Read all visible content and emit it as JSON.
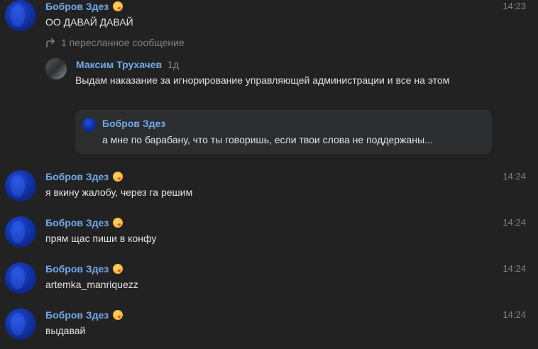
{
  "messages": [
    {
      "author": "Бобров Здез",
      "time": "14:23",
      "text": "ОО ДАВАЙ ДАВАЙ",
      "forwarded_label": "1 пересланное сообщение",
      "forwarded": {
        "author": "Максим Трухачев",
        "when": "1д",
        "text": "Выдам наказание за игнорирование управляющей администрации и все на этом",
        "reply": {
          "author": "Бобров Здез",
          "text": "а мне по барабану, что ты говоришь, если твои слова не поддержаны..."
        }
      }
    },
    {
      "author": "Бобров Здез",
      "time": "14:24",
      "text": "я вкину жалобу, через га решим"
    },
    {
      "author": "Бобров Здез",
      "time": "14:24",
      "text": "прям щас пиши в конфу"
    },
    {
      "author": "Бобров Здез",
      "time": "14:24",
      "text": "artemka_manriquezz"
    },
    {
      "author": "Бобров Здез",
      "time": "14:24",
      "text": "выдавай"
    }
  ],
  "icons": {
    "author_emoji": "face-blowing-kiss-icon",
    "forward": "forward-arrow-icon"
  },
  "colors": {
    "background": "#222222",
    "author_name": "#71aaeb",
    "text": "#e1e3e6",
    "muted": "#828282",
    "reply_box": "#2c2d2f"
  }
}
